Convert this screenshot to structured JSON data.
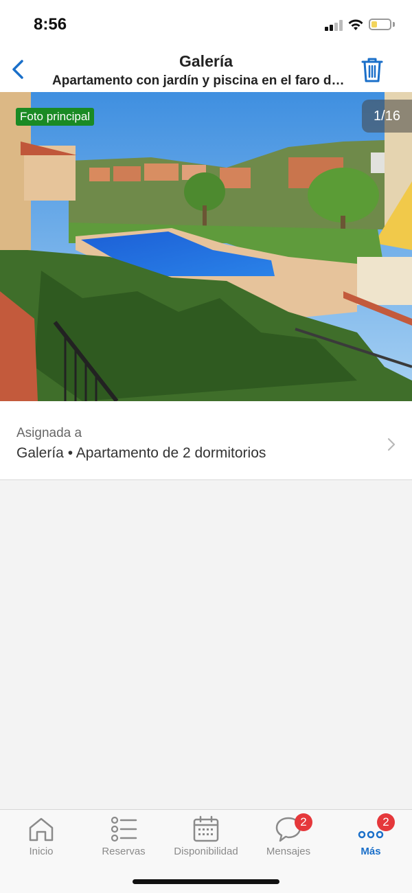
{
  "status_bar": {
    "time": "8:56"
  },
  "header": {
    "title": "Galería",
    "subtitle": "Apartamento con jardín y piscina en el faro de Calaburras"
  },
  "photo": {
    "badge": "Foto principal",
    "counter": "1/16"
  },
  "assignment": {
    "label": "Asignada a",
    "value": "Galería • Apartamento de 2 dormitorios"
  },
  "tabbar": {
    "tabs": [
      {
        "label": "Inicio",
        "icon": "home-icon"
      },
      {
        "label": "Reservas",
        "icon": "list-icon"
      },
      {
        "label": "Disponibilidad",
        "icon": "calendar-icon"
      },
      {
        "label": "Mensajes",
        "icon": "chat-bubble-icon",
        "badge": "2"
      },
      {
        "label": "Más",
        "icon": "more-dots-icon",
        "badge": "2"
      }
    ]
  },
  "colors": {
    "accent": "#1a6fc9",
    "badge_green": "#1a8a24",
    "notification_red": "#e5383b"
  }
}
